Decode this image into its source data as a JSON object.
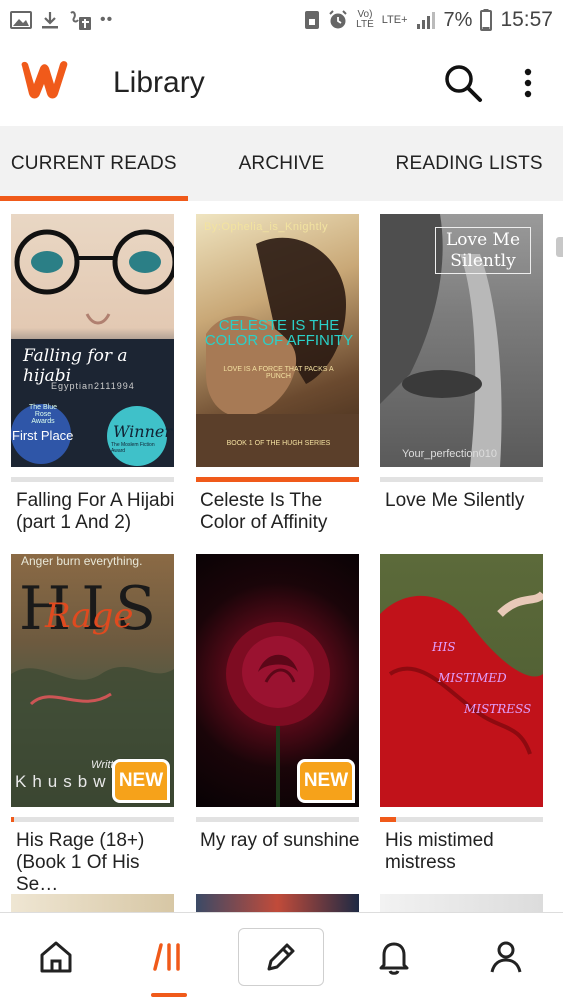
{
  "status_bar": {
    "lte_top": "Vo)",
    "lte_bottom": "LTE",
    "network": "LTE+",
    "battery": "7%",
    "time": "15:57"
  },
  "app_bar": {
    "title": "Library"
  },
  "tabs": [
    {
      "label": "CURRENT READS",
      "active": true
    },
    {
      "label": "ARCHIVE",
      "active": false
    },
    {
      "label": "READING LISTS",
      "active": false
    }
  ],
  "books": [
    {
      "title": "Falling For A Hijabi (part 1 And 2)",
      "progress": 0,
      "cover_lines": [
        "Falling for a hijabi",
        "Egyptian2111994",
        "The Blue Rose Awards",
        "First Place",
        "Winner",
        "The Moslem Fiction Award"
      ]
    },
    {
      "title": "Celeste Is The Color of Affinity",
      "progress": 1,
      "cover_lines": [
        "By:Ophelia_is_Knightly",
        "Celeste is the color of Affinity",
        "Love is a force that packs a punch",
        "Book 1 of the Hugh series"
      ]
    },
    {
      "title": "Love Me Silently",
      "progress": 0,
      "cover_lines": [
        "Love Me Silently",
        "Your_perfection010"
      ]
    },
    {
      "title": "His Rage (18+) (Book 1 Of His Se…",
      "progress": 0.02,
      "badge": "NEW",
      "cover_lines": [
        "Anger burn everything.",
        "HIS",
        "Rage",
        "Written",
        "Khusbw"
      ]
    },
    {
      "title": "My ray of sunshine",
      "progress": 0,
      "badge": "NEW",
      "cover_lines": []
    },
    {
      "title": "His mistimed mistress",
      "progress": 0.1,
      "cover_lines": [
        "HIS",
        "MISTIMED",
        "MISTRESS"
      ]
    }
  ],
  "colors": {
    "accent": "#f05a1a",
    "badge": "#f6a21a"
  },
  "bottom_nav": [
    "home-icon",
    "library-icon",
    "pencil-icon",
    "bell-icon",
    "profile-icon"
  ]
}
